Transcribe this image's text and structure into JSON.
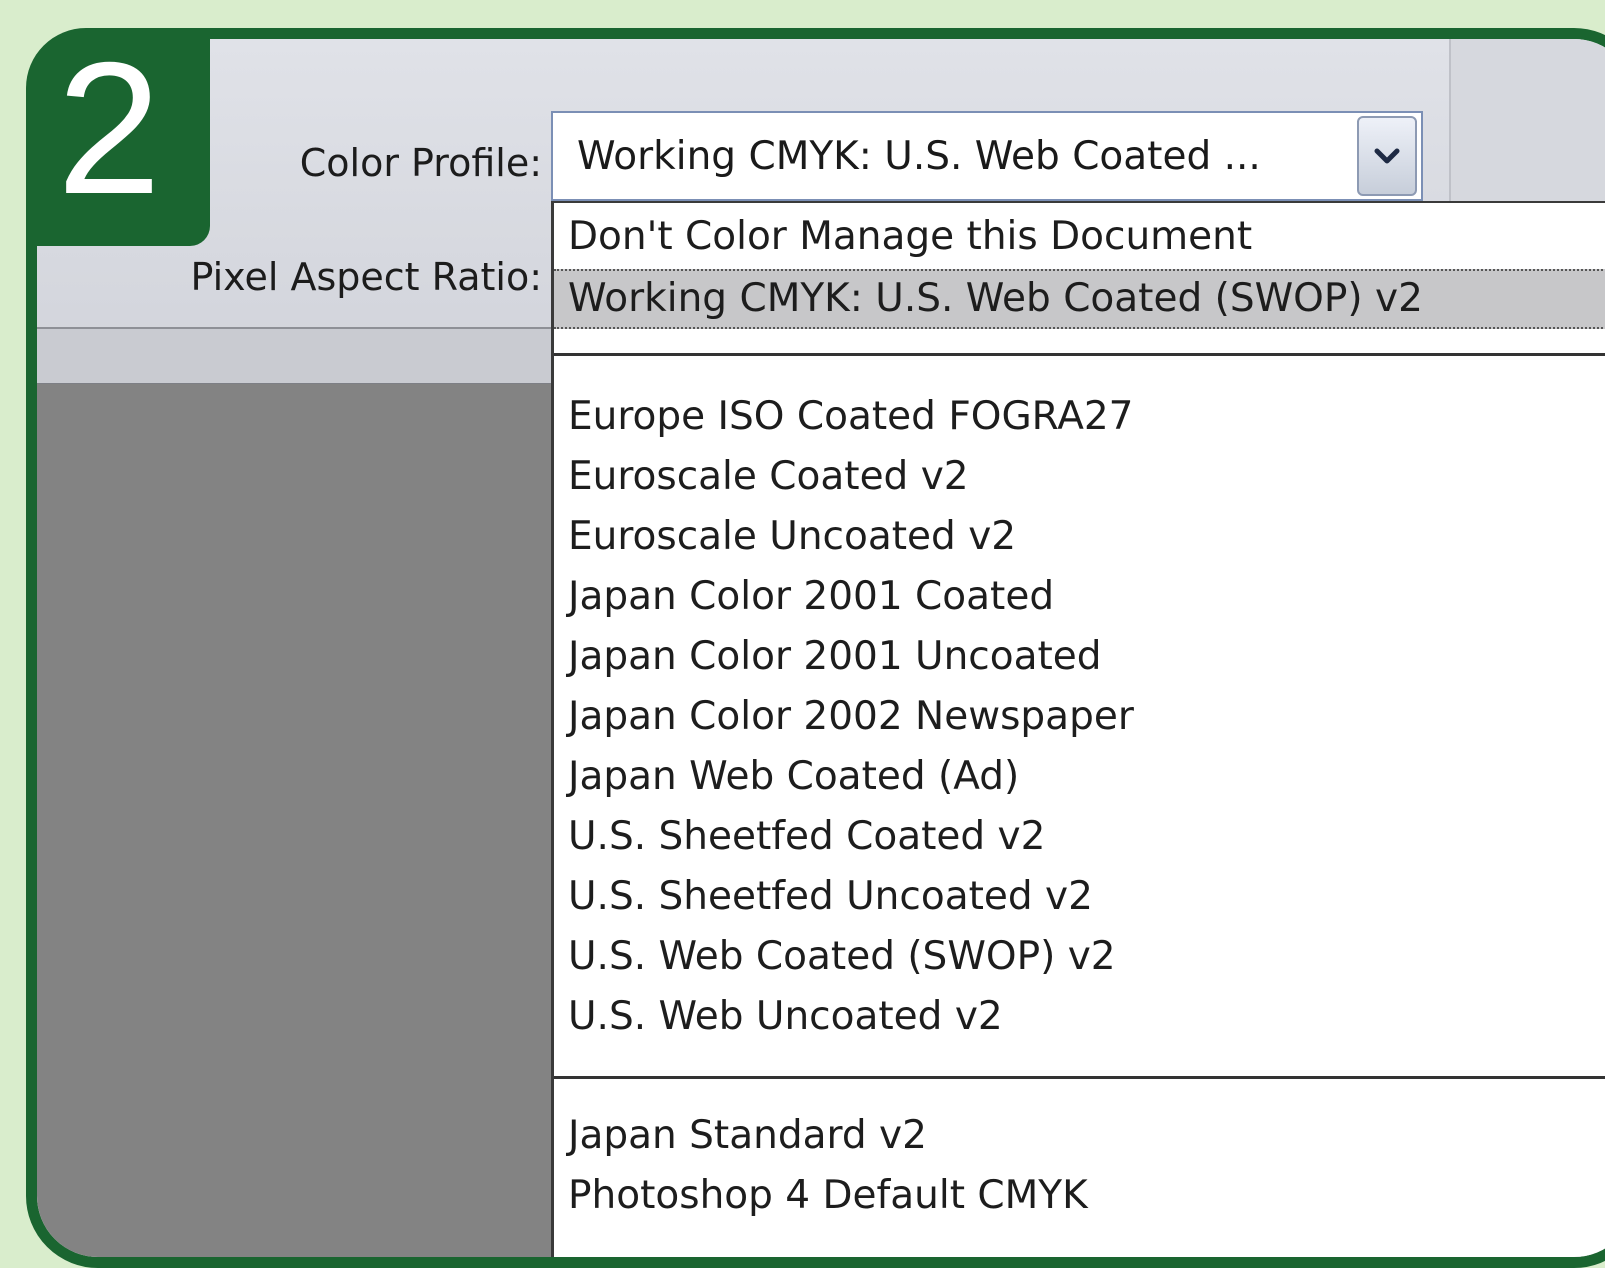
{
  "step": {
    "number": "2"
  },
  "form": {
    "color_profile_label": "Color Profile:",
    "pixel_aspect_label": "Pixel Aspect Ratio:",
    "color_profile_value": "Working CMYK:  U.S. Web Coated ..."
  },
  "dropdown": {
    "top_items": [
      "Don't Color Manage this Document",
      "Working CMYK:  U.S. Web Coated (SWOP) v2"
    ],
    "selected_index": 1,
    "profiles": [
      "Europe ISO Coated FOGRA27",
      "Euroscale Coated v2",
      "Euroscale Uncoated v2",
      "Japan Color 2001 Coated",
      "Japan Color 2001 Uncoated",
      "Japan Color 2002 Newspaper",
      "Japan Web Coated (Ad)",
      "U.S. Sheetfed Coated v2",
      "U.S. Sheetfed Uncoated v2",
      "U.S. Web Coated (SWOP) v2",
      "U.S. Web Uncoated v2"
    ],
    "more_profiles": [
      "Japan Standard v2",
      "Photoshop 4 Default CMYK"
    ]
  },
  "colors": {
    "brand_green": "#1a6530",
    "background": "#d9edcc",
    "selection": "#c7c7c9"
  },
  "icons": {
    "dropdown": "chevron-down-icon"
  }
}
